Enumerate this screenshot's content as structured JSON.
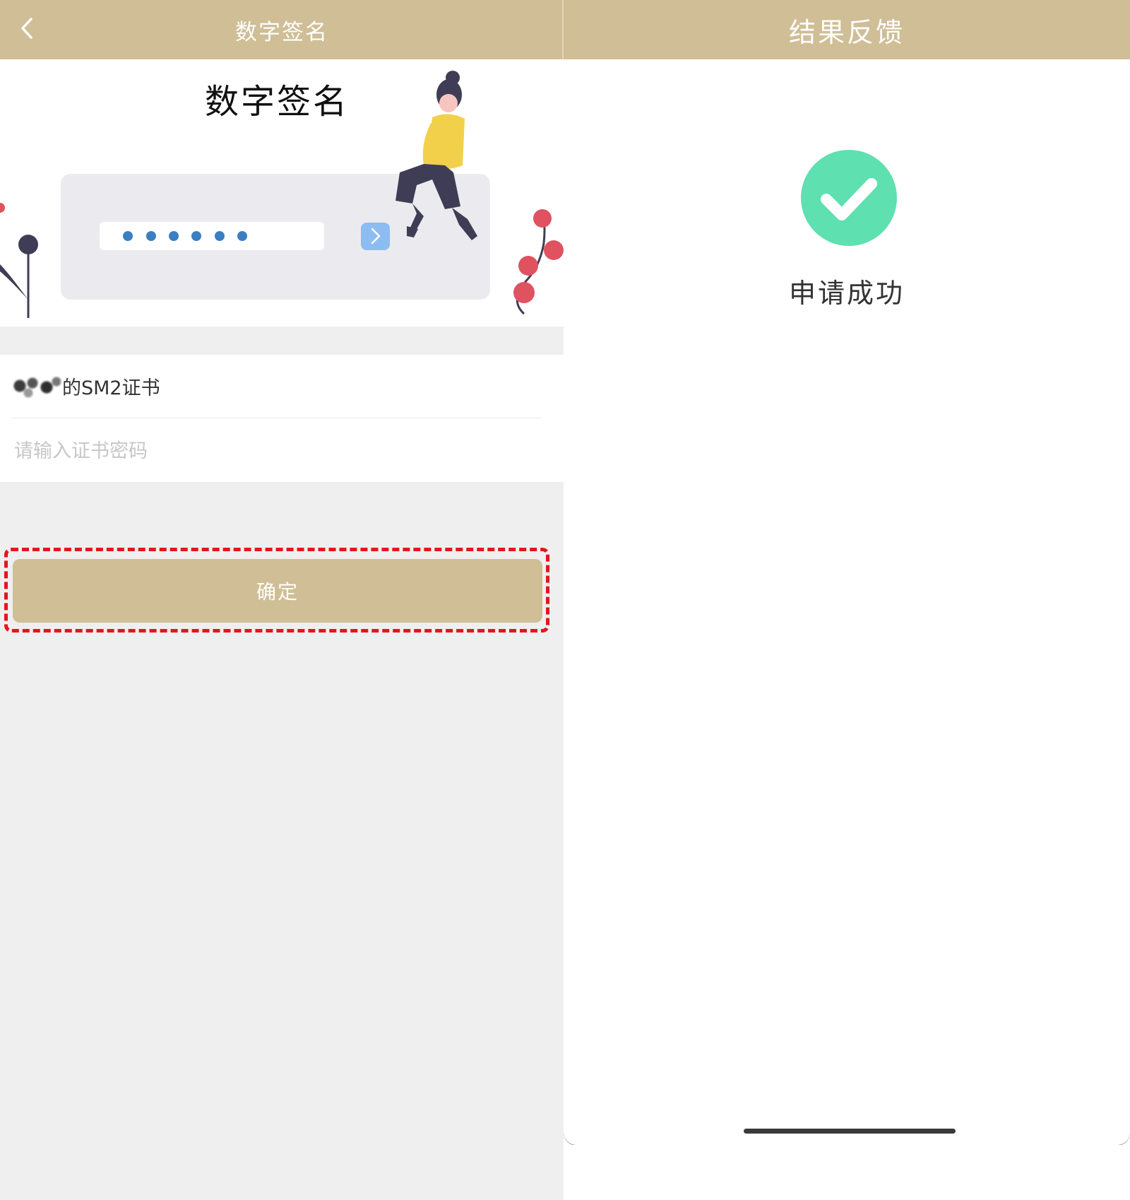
{
  "left_screen": {
    "header": {
      "title": "数字签名",
      "back_icon": "chevron-left-icon"
    },
    "hero": {
      "title": "数字签名",
      "illustration_icon": "password-illustration",
      "masked_dots": 6,
      "colors": {
        "dots": "#3a7fc1",
        "arrow_button": "#8dbcf2",
        "card": "#ebebef",
        "berries": "#e05260",
        "shirt": "#f2d04a"
      }
    },
    "certificate": {
      "label": "的SM2证书",
      "owner_name_redacted": true
    },
    "password_field": {
      "placeholder": "请输入证书密码",
      "value": ""
    },
    "confirm_button": {
      "label": "确定"
    }
  },
  "right_screen": {
    "header": {
      "title": "结果反馈"
    },
    "result": {
      "status_icon": "check-circle-icon",
      "message": "申请成功"
    }
  },
  "colors": {
    "header_bg": "#cfbe96",
    "button_bg": "#cfbe96",
    "success_green": "#5ee0b0",
    "page_bg": "#efefef",
    "highlight_dash": "#e3161b"
  }
}
